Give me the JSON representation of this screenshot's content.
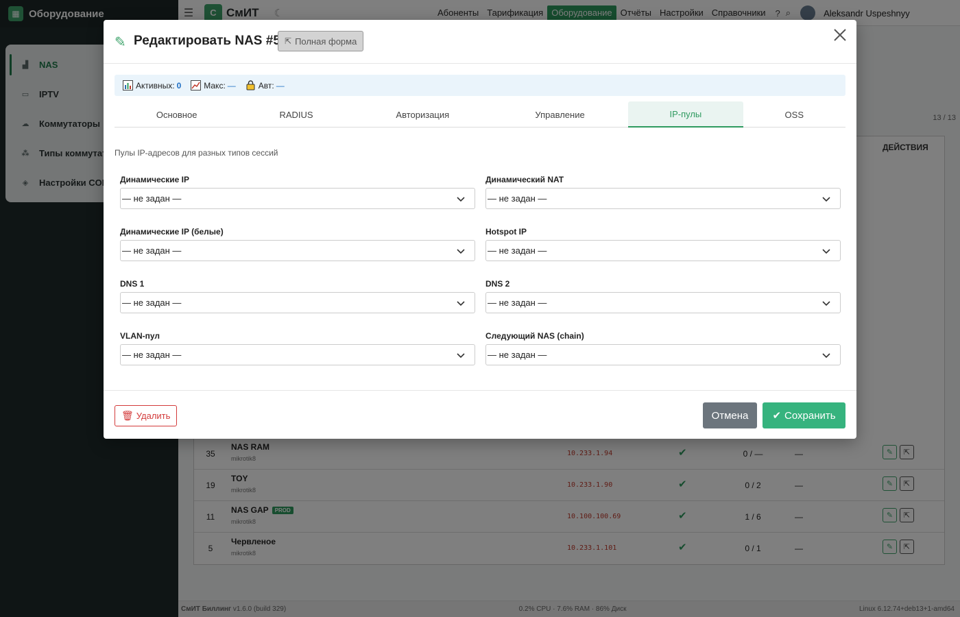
{
  "sidebar": {
    "app_title": "Оборудование",
    "items": [
      {
        "label": "NAS",
        "icon": "network-icon"
      },
      {
        "label": "IPTV",
        "icon": "tv-icon"
      },
      {
        "label": "Коммутаторы",
        "icon": "switch-icon"
      },
      {
        "label": "Типы коммутат",
        "icon": "hierarchy-icon"
      },
      {
        "label": "Настройки COF",
        "icon": "shield-icon"
      }
    ]
  },
  "topbar": {
    "brand": "СмИТ",
    "brand_letter": "С",
    "nav": [
      "Абоненты",
      "Тарификация",
      "Оборудование",
      "Отчёты",
      "Настройки",
      "Справочники"
    ],
    "active_nav": "Оборудование",
    "user": "Aleksandr Uspeshnyy"
  },
  "table": {
    "counter": "13 / 13",
    "actions_header": "ДЕЙСТВИЯ",
    "rows": [
      {
        "id": "35",
        "name": "NAS RAM",
        "sub": "mikrotik8",
        "ip": "10.233.1.94",
        "count": "0 / —",
        "dash": "—",
        "badge": ""
      },
      {
        "id": "19",
        "name": "TOY",
        "sub": "mikrotik8",
        "ip": "10.233.1.90",
        "count": "0 / 2",
        "dash": "—",
        "badge": ""
      },
      {
        "id": "11",
        "name": "NAS GAP",
        "sub": "mikrotik8",
        "ip": "10.100.100.69",
        "count": "1 / 6",
        "dash": "—",
        "badge": "PROD"
      },
      {
        "id": "5",
        "name": "Червленое",
        "sub": "mikrotik8",
        "ip": "10.233.1.101",
        "count": "0 / 1",
        "dash": "—",
        "badge": ""
      }
    ]
  },
  "footer": {
    "left_name": "СмИТ Биллинг",
    "left_version": "v1.6.0 (build 329)",
    "center": "0.2% CPU · 7.6% RAM · 86% Диск",
    "right": "Linux 6.12.74+deb13+1-amd64"
  },
  "modal": {
    "title": "Редактировать NAS #56",
    "full_form": "Полная форма",
    "stats": {
      "active_label": "Активных:",
      "active_value": "0",
      "max_label": "Макс:",
      "max_value": "—",
      "auth_label": "Авт:",
      "auth_value": "—"
    },
    "tabs": [
      "Основное",
      "RADIUS",
      "Авторизация",
      "Управление",
      "IP-пулы",
      "OSS"
    ],
    "active_tab": "IP-пулы",
    "section_desc": "Пулы IP-адресов для разных типов сессий",
    "fields": [
      {
        "label": "Динамические IP",
        "value": "— не задан —"
      },
      {
        "label": "Динамический NAT",
        "value": "— не задан —"
      },
      {
        "label": "Динамические IP (белые)",
        "value": "— не задан —"
      },
      {
        "label": "Hotspot IP",
        "value": "— не задан —"
      },
      {
        "label": "DNS 1",
        "value": "— не задан —"
      },
      {
        "label": "DNS 2",
        "value": "— не задан —"
      },
      {
        "label": "VLAN-пул",
        "value": "— не задан —"
      },
      {
        "label": "Следующий NAS (chain)",
        "value": "— не задан —"
      }
    ],
    "delete_label": "Удалить",
    "cancel_label": "Отмена",
    "save_label": "Сохранить"
  }
}
